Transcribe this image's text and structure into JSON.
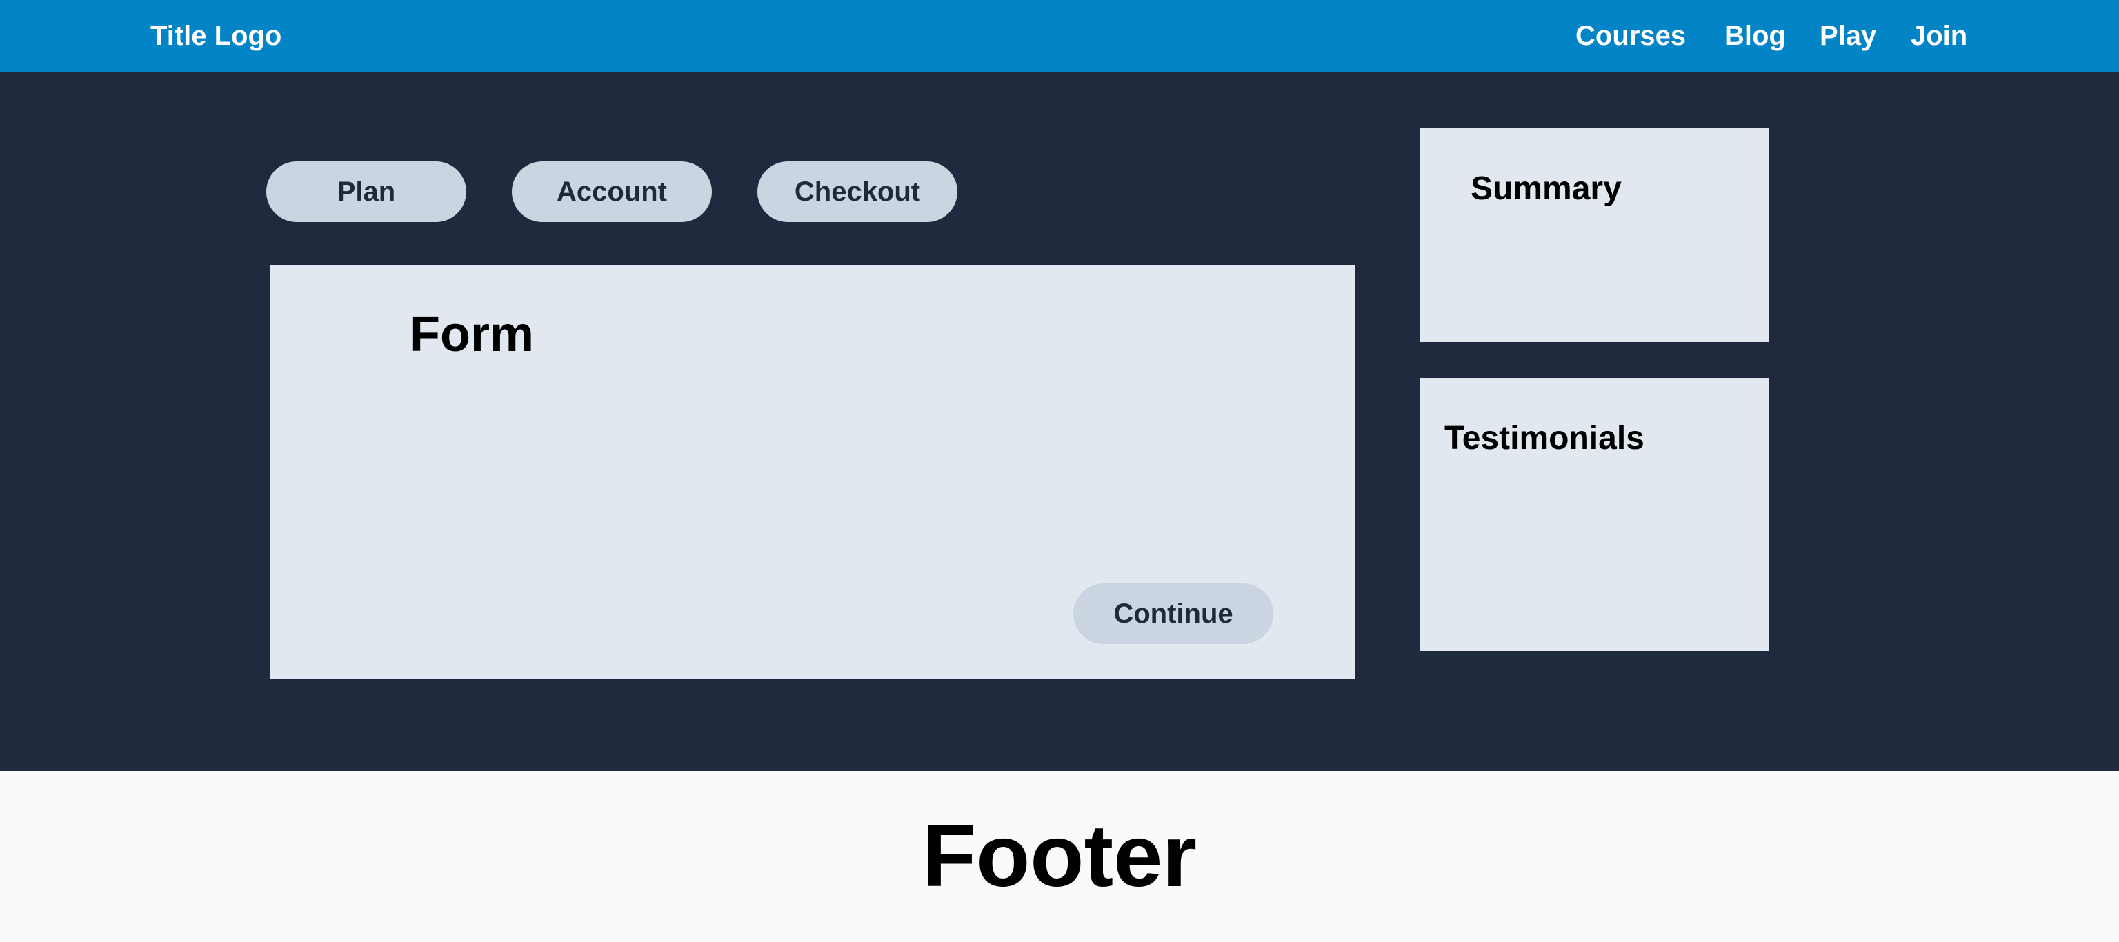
{
  "header": {
    "logo": "Title Logo",
    "nav": [
      "Courses",
      "Blog",
      "Play",
      "Join"
    ]
  },
  "steps": [
    "Plan",
    "Account",
    "Checkout"
  ],
  "form": {
    "title": "Form",
    "continue_label": "Continue"
  },
  "sidebar": {
    "summary_title": "Summary",
    "testimonials_title": "Testimonials"
  },
  "footer": {
    "title": "Footer"
  },
  "colors": {
    "header_bg": "#0284c7",
    "main_bg": "#1f2a3e",
    "panel_bg": "#e2e8f0",
    "pill_bg": "#cbd5e1",
    "footer_bg": "#f8fafc"
  }
}
